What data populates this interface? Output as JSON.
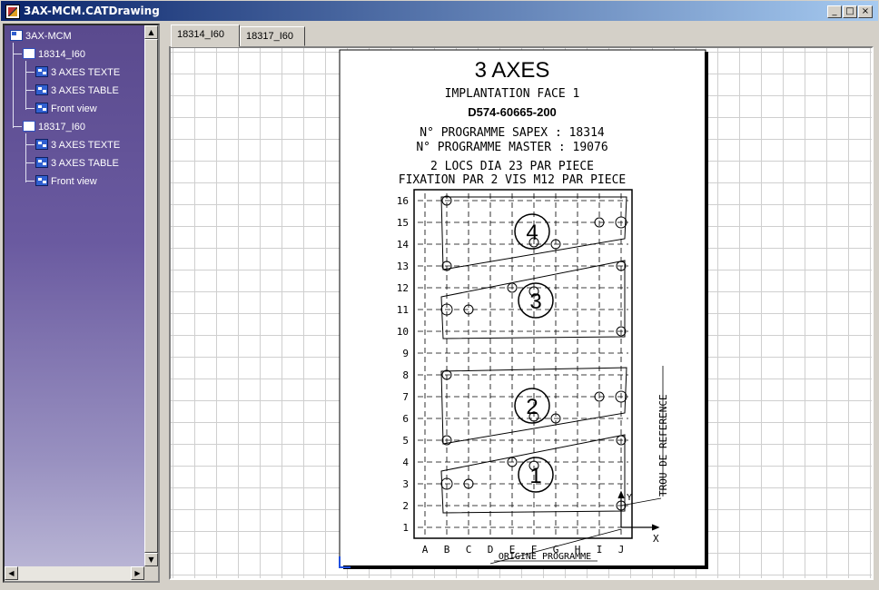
{
  "window": {
    "title": "3AX-MCM.CATDrawing",
    "buttons": {
      "minimize": "_",
      "maximize": "□",
      "close": "×"
    }
  },
  "tree": {
    "root": "3AX-MCM",
    "sheets": [
      {
        "label": "18314_I60",
        "items": [
          "3 AXES TEXTE",
          "3 AXES TABLE",
          "Front view"
        ]
      },
      {
        "label": "18317_I60",
        "items": [
          "3 AXES TEXTE",
          "3 AXES TABLE",
          "Front view"
        ]
      }
    ]
  },
  "tabs": [
    {
      "label": "18314_I60",
      "active": true
    },
    {
      "label": "18317_I60",
      "active": false
    }
  ],
  "drawing": {
    "title": "3 AXES",
    "subtitle": "IMPLANTATION FACE 1",
    "part_number": "D574-60665-200",
    "programme_sapex": "N° PROGRAMME SAPEX : 18314",
    "programme_master": "N° PROGRAMME MASTER : 19076",
    "locs": "2 LOCS DIA 23 PAR PIECE",
    "fixation": "FIXATION PAR 2 VIS M12 PAR PIECE",
    "row_labels": [
      "16",
      "15",
      "14",
      "13",
      "12",
      "11",
      "10",
      "9",
      "8",
      "7",
      "6",
      "5",
      "4",
      "3",
      "2",
      "1"
    ],
    "col_labels": [
      "A",
      "B",
      "C",
      "D",
      "E",
      "F",
      "G",
      "H",
      "I",
      "J"
    ],
    "piece_numbers": [
      "4",
      "3",
      "2",
      "1"
    ],
    "trou_label": "TROU DE REFERENCE",
    "origine_label": "ORIGINE PROGRAMME",
    "axis_x": "X",
    "axis_y": "Y"
  }
}
